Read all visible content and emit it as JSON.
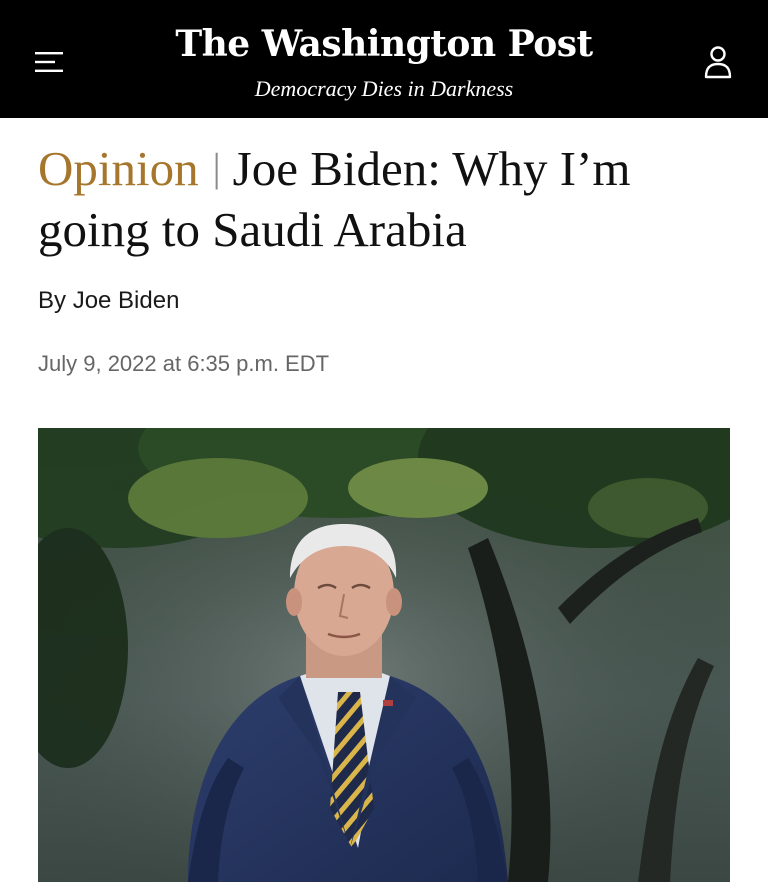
{
  "header": {
    "logo_text": "The Washington Post",
    "tagline": "Democracy Dies in Darkness",
    "menu_icon": "hamburger-menu-icon",
    "account_icon": "user-account-icon",
    "background_color": "#000000"
  },
  "article": {
    "kicker": "Opinion",
    "separator": "|",
    "title": "Joe Biden: Why I’m going to Saudi Arabia",
    "byline_prefix": "By",
    "author": "Joe Biden",
    "timestamp": "July 9, 2022 at 6:35 p.m. EDT",
    "kicker_color": "#a5762c",
    "lead_image_subject": "man in navy suit with striped tie walking outdoors in front of trees"
  }
}
